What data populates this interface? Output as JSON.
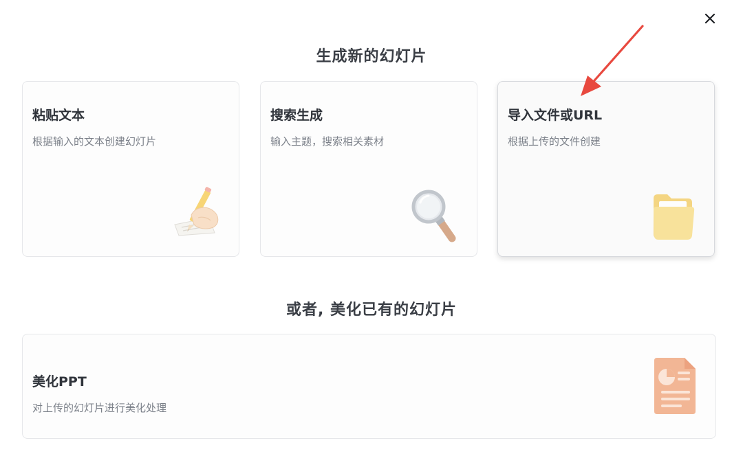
{
  "dialog": {
    "close_label": "×"
  },
  "sections": {
    "create_title": "生成新的幻灯片",
    "beautify_title": "或者, 美化已有的幻灯片"
  },
  "cards": [
    {
      "title": "粘贴文本",
      "description": "根据输入的文本创建幻灯片",
      "icon": "pencil-writing-icon"
    },
    {
      "title": "搜索生成",
      "description": "输入主题，搜索相关素材",
      "icon": "magnifier-icon"
    },
    {
      "title": "导入文件或URL",
      "description": "根据上传的文件创建",
      "icon": "folder-icon"
    }
  ],
  "beautify_card": {
    "title": "美化PPT",
    "description": "对上传的幻灯片进行美化处理",
    "icon": "presentation-file-icon"
  },
  "annotation": {
    "arrow_color": "#e8493f"
  }
}
